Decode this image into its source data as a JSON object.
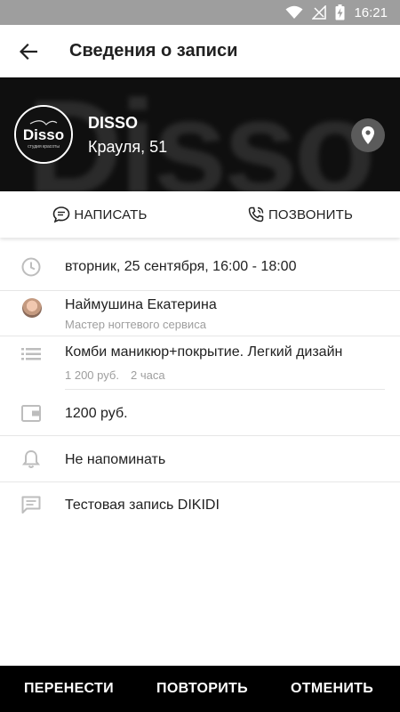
{
  "status_bar": {
    "time": "16:21",
    "icons": [
      "wifi-icon",
      "signal-icon",
      "battery-charging-icon"
    ]
  },
  "app_bar": {
    "title": "Сведения о записи",
    "back_icon": "arrow-back-icon"
  },
  "salon": {
    "name": "DISSO",
    "address": "Крауля, 51",
    "logo_text": "Disso",
    "logo_subtext": "студия красоты",
    "background_text": "Disso",
    "map_icon": "location-pin-icon"
  },
  "contact_actions": {
    "message_label": "НАПИСАТЬ",
    "call_label": "ПОЗВОНИТЬ"
  },
  "details": {
    "datetime": "вторник, 25 сентября, 16:00 - 18:00",
    "master_name": "Наймушина Екатерина",
    "master_role": "Мастер ногтевого сервиса",
    "service_name": "Комби маникюр+покрытие. Легкий дизайн",
    "service_price": "1 200 руб.",
    "service_duration": "2 часа",
    "total_price": "1200 руб.",
    "reminder": "Не напоминать",
    "comment": "Тестовая запись DIKIDI"
  },
  "bottom_actions": {
    "reschedule_label": "ПЕРЕНЕСТИ",
    "repeat_label": "ПОВТОРИТЬ",
    "cancel_label": "ОТМЕНИТЬ"
  },
  "colors": {
    "status_bar": "#9e9e9e",
    "hero_bg": "#151515",
    "bottom_bar": "#000000",
    "secondary_text": "#9e9e9e",
    "icon_gray": "#bdbdbd"
  }
}
